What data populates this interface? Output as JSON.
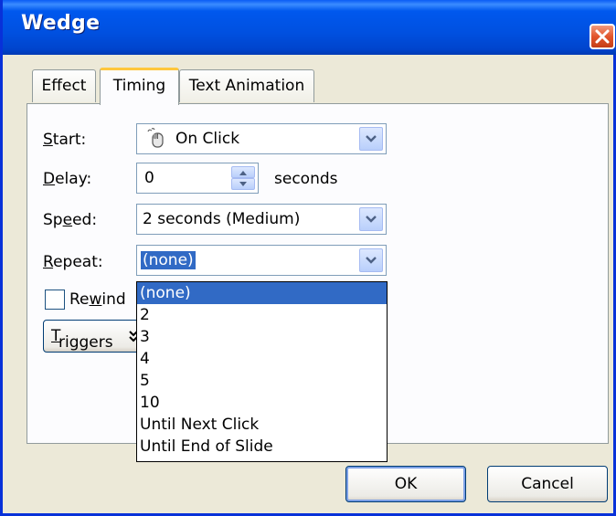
{
  "window": {
    "title": "Wedge"
  },
  "tabs": [
    {
      "label": "Effect",
      "active": false
    },
    {
      "label": "Timing",
      "active": true
    },
    {
      "label": "Text Animation",
      "active": false
    }
  ],
  "timing": {
    "start": {
      "label_pre": "",
      "label_key": "S",
      "label_post": "tart:",
      "value": "On Click",
      "icon": "mouse-icon"
    },
    "delay": {
      "label_pre": "",
      "label_key": "D",
      "label_post": "elay:",
      "value": "0",
      "unit": "seconds"
    },
    "speed": {
      "label_pre": "Sp",
      "label_key": "e",
      "label_post": "ed:",
      "value": "2 seconds (Medium)"
    },
    "repeat": {
      "label_pre": "",
      "label_key": "R",
      "label_post": "epeat:",
      "value": "(none)",
      "options": [
        "(none)",
        "2",
        "3",
        "4",
        "5",
        "10",
        "Until Next Click",
        "Until End of Slide"
      ],
      "highlighted_index": 0
    },
    "rewind": {
      "label_pre": "Re",
      "label_key": "w",
      "label_post": "ind",
      "checked": false
    },
    "triggers": {
      "label_pre": "",
      "label_key": "T",
      "label_post": "riggers"
    }
  },
  "buttons": {
    "ok": "OK",
    "cancel": "Cancel"
  },
  "colors": {
    "title_bar": "#0054e3",
    "highlight": "#316ac5",
    "dialog_bg": "#ece9d8",
    "tab_accent": "#ffc73c"
  }
}
